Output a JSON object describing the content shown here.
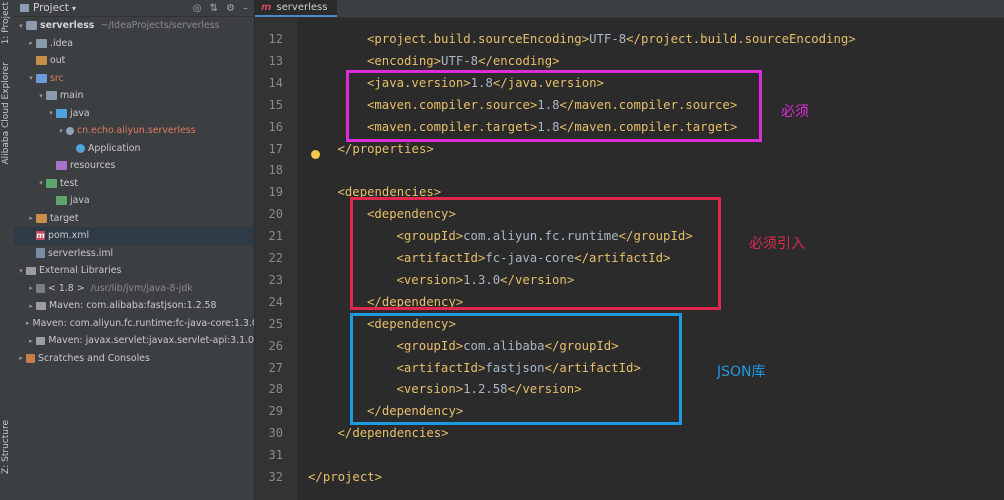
{
  "side_tabs": {
    "project": "1: Project",
    "alibaba": "Alibaba Cloud Explorer",
    "structure": "Z: Structure"
  },
  "project_panel": {
    "title": "Project",
    "items": [
      {
        "label": "serverless",
        "extra": "~/IdeaProjects/serverless",
        "kind": "module"
      },
      {
        "label": ".idea",
        "kind": "folder"
      },
      {
        "label": "out",
        "kind": "folder-target"
      },
      {
        "label": "src",
        "kind": "folder-src"
      },
      {
        "label": "main",
        "kind": "folder"
      },
      {
        "label": "java",
        "kind": "folder-java"
      },
      {
        "label": "cn.echo.aliyun.serverless",
        "kind": "package"
      },
      {
        "label": "Application",
        "kind": "class"
      },
      {
        "label": "resources",
        "kind": "folder-res"
      },
      {
        "label": "test",
        "kind": "folder-test"
      },
      {
        "label": "java",
        "kind": "folder-test"
      },
      {
        "label": "target",
        "kind": "folder-target"
      },
      {
        "label": "pom.xml",
        "kind": "maven"
      },
      {
        "label": "serverless.iml",
        "kind": "iml"
      },
      {
        "label": "External Libraries",
        "kind": "lib"
      },
      {
        "label": "< 1.8 >",
        "extra": "/usr/lib/jvm/java-8-jdk",
        "kind": "jdk"
      },
      {
        "label": "Maven: com.alibaba:fastjson:1.2.58",
        "kind": "lib"
      },
      {
        "label": "Maven: com.aliyun.fc.runtime:fc-java-core:1.3.0",
        "kind": "lib"
      },
      {
        "label": "Maven: javax.servlet:javax.servlet-api:3.1.0",
        "kind": "lib"
      },
      {
        "label": "Scratches and Consoles",
        "kind": "scratch"
      }
    ]
  },
  "editor": {
    "tab_label": "serverless",
    "lines": [
      {
        "n": "12",
        "indent": 2,
        "tag": "project.build.sourceEncoding",
        "value": "UTF-8"
      },
      {
        "n": "13",
        "indent": 2,
        "tag": "encoding",
        "value": "UTF-8"
      },
      {
        "n": "14",
        "indent": 2,
        "tag": "java.version",
        "value": "1.8"
      },
      {
        "n": "15",
        "indent": 2,
        "tag": "maven.compiler.source",
        "value": "1.8"
      },
      {
        "n": "16",
        "indent": 2,
        "tag": "maven.compiler.target",
        "value": "1.8"
      },
      {
        "n": "17",
        "indent": 1,
        "close": "properties"
      },
      {
        "n": "18",
        "indent": 0,
        "blank": true
      },
      {
        "n": "19",
        "indent": 1,
        "open": "dependencies"
      },
      {
        "n": "20",
        "indent": 2,
        "open": "dependency"
      },
      {
        "n": "21",
        "indent": 3,
        "tag": "groupId",
        "value": "com.aliyun.fc.runtime"
      },
      {
        "n": "22",
        "indent": 3,
        "tag": "artifactId",
        "value": "fc-java-core"
      },
      {
        "n": "23",
        "indent": 3,
        "tag": "version",
        "value": "1.3.0"
      },
      {
        "n": "24",
        "indent": 2,
        "close": "dependency"
      },
      {
        "n": "25",
        "indent": 2,
        "open": "dependency"
      },
      {
        "n": "26",
        "indent": 3,
        "tag": "groupId",
        "value": "com.alibaba"
      },
      {
        "n": "27",
        "indent": 3,
        "tag": "artifactId",
        "value": "fastjson"
      },
      {
        "n": "28",
        "indent": 3,
        "tag": "version",
        "value": "1.2.58"
      },
      {
        "n": "29",
        "indent": 2,
        "close": "dependency"
      },
      {
        "n": "30",
        "indent": 1,
        "close": "dependencies"
      },
      {
        "n": "31",
        "indent": 0,
        "blank": true
      },
      {
        "n": "32",
        "indent": 0,
        "close": "project"
      }
    ]
  },
  "annotations": {
    "required": "必须",
    "required_import": "必须引入",
    "json_lib": "JSON库"
  },
  "colors": {
    "magenta": "#e02bd8",
    "crimson": "#e0284f",
    "blue": "#1e9be0"
  }
}
